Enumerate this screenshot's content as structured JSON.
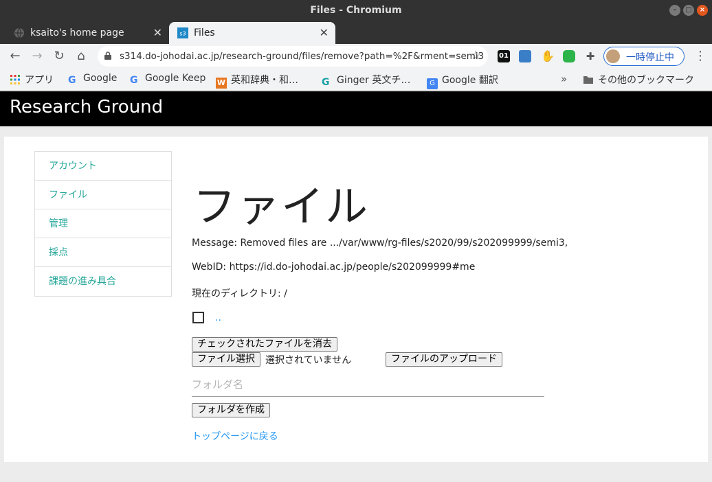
{
  "window": {
    "title": "Files - Chromium"
  },
  "tabs": [
    {
      "label": "ksaito's home page",
      "favicon": "globe-icon"
    },
    {
      "label": "Files",
      "favicon": "site-icon"
    }
  ],
  "toolbar": {
    "url": "s314.do-johodai.ac.jp/research-ground/files/remove?path=%2F&rment=semi3",
    "profile_label": "一時停止中",
    "ext_01": "01"
  },
  "bookmarks": [
    {
      "label": "アプリ"
    },
    {
      "label": "Google"
    },
    {
      "label": "Google Keep"
    },
    {
      "label": "英和辞典・和…"
    },
    {
      "label": "Ginger 英文チ…"
    },
    {
      "label": "Google 翻訳"
    },
    {
      "label": "その他のブックマーク"
    }
  ],
  "site": {
    "brand": "Research Ground"
  },
  "sidenav": [
    {
      "label": "アカウント"
    },
    {
      "label": "ファイル"
    },
    {
      "label": "管理"
    },
    {
      "label": "採点"
    },
    {
      "label": "課題の進み具合"
    }
  ],
  "main": {
    "title": "ファイル",
    "message": "Message: Removed files are .../var/www/rg-files/s2020/99/s202099999/semi3,",
    "webid": "WebID: https://id.do-johodai.ac.jp/people/s202099999#me",
    "current_dir": "現在のディレクトリ: /",
    "dir_entry": "..",
    "delete_button": "チェックされたファイルを消去",
    "choose_file_button": "ファイル選択",
    "no_file_selected": "選択されていません",
    "upload_button": "ファイルのアップロード",
    "folder_placeholder": "フォルダ名",
    "create_folder_button": "フォルダを作成",
    "back_link": "トップページに戻る"
  }
}
